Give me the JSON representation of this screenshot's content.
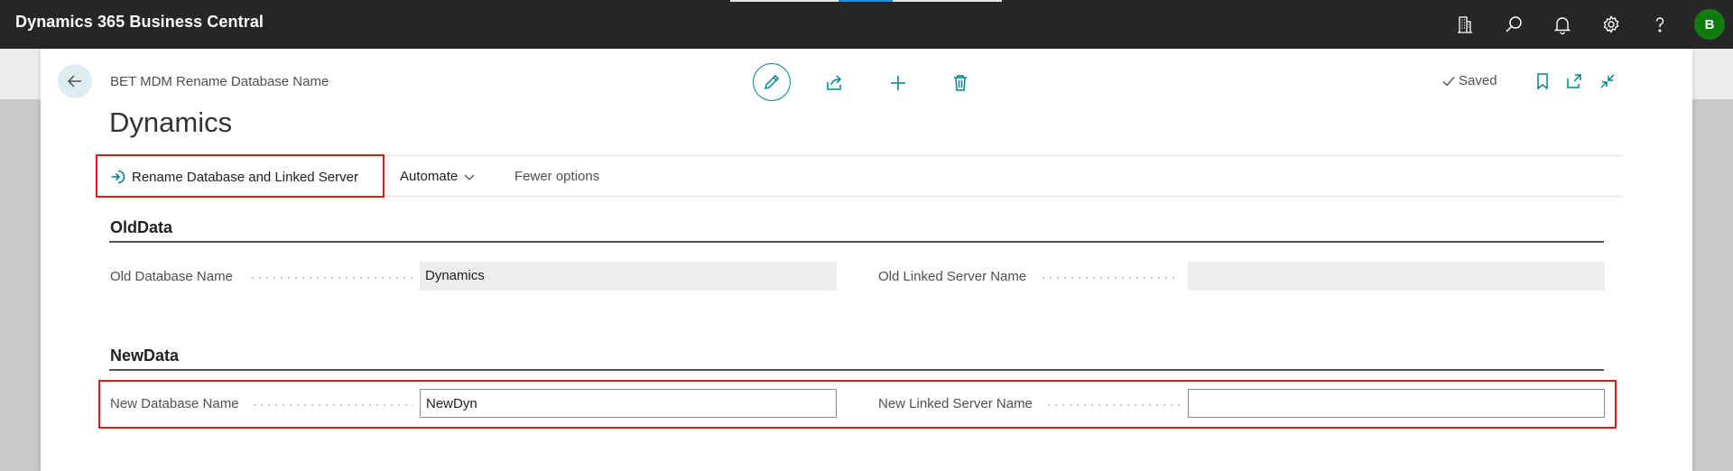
{
  "app": {
    "title": "Dynamics 365 Business Central",
    "avatar_initial": "B"
  },
  "colors": {
    "accent": "#00838f",
    "topbar": "#262626",
    "highlight": "#e0161d",
    "avatar": "#107c10"
  },
  "topbar_icons": [
    "building-icon",
    "search-icon",
    "bell-icon",
    "gear-icon",
    "help-icon"
  ],
  "page": {
    "breadcrumb": "BET MDM Rename Database Name",
    "title": "Dynamics",
    "status": "Saved"
  },
  "actions": {
    "primary": "Rename Database and Linked Server",
    "automate": "Automate",
    "fewer_options": "Fewer options"
  },
  "sections": {
    "old": {
      "title": "OldData",
      "db_label": "Old Database Name",
      "db_value": "Dynamics",
      "server_label": "Old Linked Server Name",
      "server_value": ""
    },
    "new": {
      "title": "NewData",
      "db_label": "New Database Name",
      "db_value": "NewDyn",
      "server_label": "New Linked Server Name",
      "server_value": ""
    }
  }
}
